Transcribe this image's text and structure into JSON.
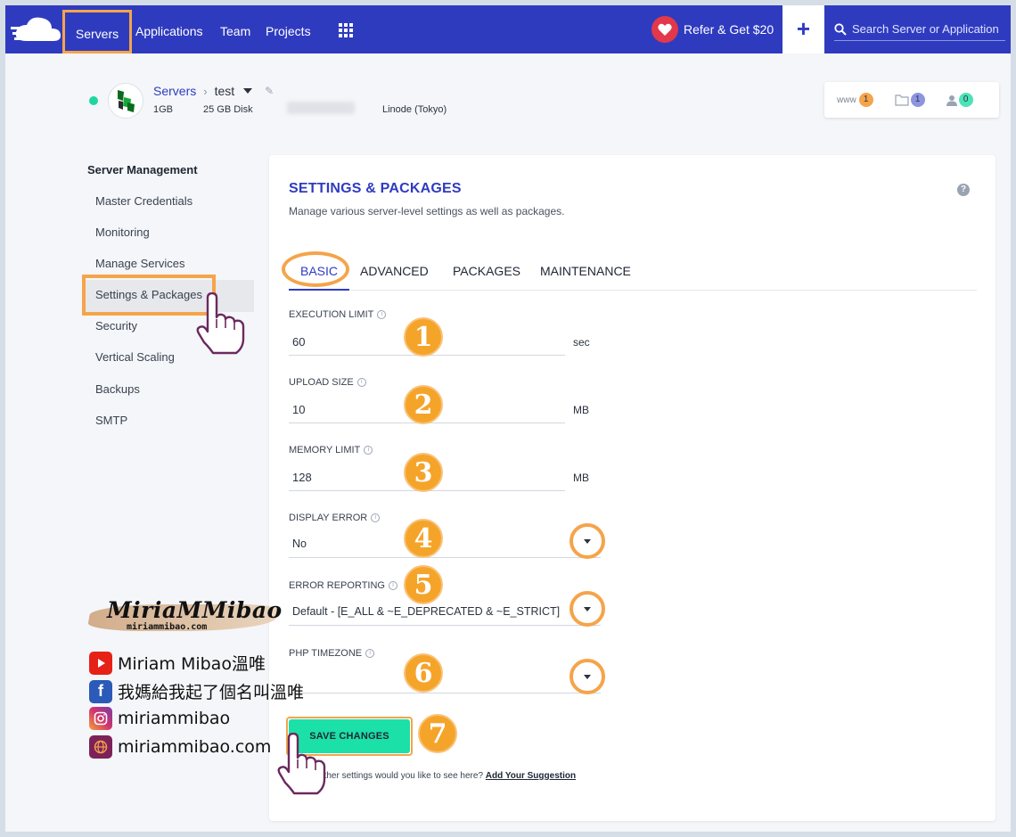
{
  "nav": {
    "items": [
      "Servers",
      "Applications",
      "Team",
      "Projects"
    ],
    "refer": "Refer & Get $20",
    "search_placeholder": "Search Server or Application"
  },
  "server": {
    "breadcrumb_root": "Servers",
    "name": "test",
    "ram": "1GB",
    "disk": "25 GB Disk",
    "location": "Linode (Tokyo)"
  },
  "stats": [
    {
      "label": "www",
      "count": "1",
      "color": "#f5a44a",
      "icon": "www-icon"
    },
    {
      "label": "",
      "count": "1",
      "color": "#8d95e0",
      "icon": "folder-icon"
    },
    {
      "label": "",
      "count": "0",
      "color": "#4be3b8",
      "icon": "user-icon"
    }
  ],
  "sidebar": {
    "title": "Server Management",
    "items": [
      "Master Credentials",
      "Monitoring",
      "Manage Services",
      "Settings & Packages",
      "Security",
      "Vertical Scaling",
      "Backups",
      "SMTP"
    ],
    "active": "Settings & Packages"
  },
  "card": {
    "title": "SETTINGS & PACKAGES",
    "subtitle": "Manage various server-level settings as well as packages.",
    "tabs": [
      "BASIC",
      "ADVANCED",
      "PACKAGES",
      "MAINTENANCE"
    ],
    "active_tab": "BASIC"
  },
  "fields": {
    "execution_limit": {
      "label": "EXECUTION LIMIT",
      "value": "60",
      "unit": "sec"
    },
    "upload_size": {
      "label": "UPLOAD SIZE",
      "value": "10",
      "unit": "MB"
    },
    "memory_limit": {
      "label": "MEMORY LIMIT",
      "value": "128",
      "unit": "MB"
    },
    "display_error": {
      "label": "DISPLAY ERROR",
      "value": "No"
    },
    "error_reporting": {
      "label": "ERROR REPORTING",
      "value": "Default - [E_ALL & ~E_DEPRECATED & ~E_STRICT]"
    },
    "php_timezone": {
      "label": "PHP TIMEZONE",
      "value": ""
    }
  },
  "save_label": "SAVE CHANGES",
  "suggestion": {
    "prefix": "other settings would you like to see here?",
    "link": "Add Your Suggestion"
  },
  "annotations": [
    "1",
    "2",
    "3",
    "4",
    "5",
    "6",
    "7"
  ],
  "watermark": {
    "brand": "MiriaMMibao",
    "url": "miriammibao.com",
    "youtube": "Miriam Mibao溫唯",
    "facebook": "我媽給我起了個名叫溫唯",
    "instagram": "miriammibao",
    "website": "miriammibao.com"
  },
  "colors": {
    "nav_bg": "#2f3bbf",
    "accent": "#2f3bbf",
    "highlight": "#f5a44a",
    "save": "#1be0a8"
  }
}
